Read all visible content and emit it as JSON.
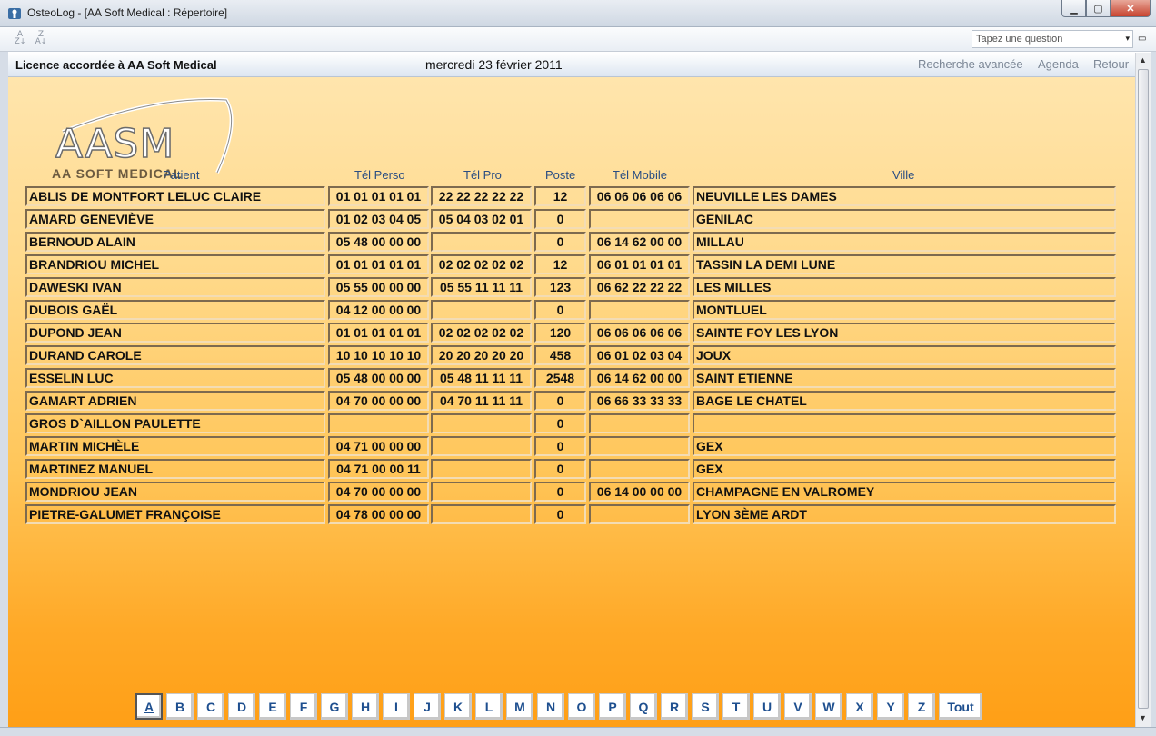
{
  "window": {
    "title": "OsteoLog - [AA Soft Medical : Répertoire]",
    "minimize": "▁",
    "maximize": "▢",
    "close": "✕"
  },
  "toolbar": {
    "sort_asc": "A↓Z",
    "sort_desc": "Z↓A",
    "question_placeholder": "Tapez une question",
    "question_arrow": "▾",
    "restore": "▭"
  },
  "header": {
    "licence": "Licence accordée à AA Soft Medical",
    "date": "mercredi 23 février 2011",
    "links": [
      "Recherche avancée",
      "Agenda",
      "Retour"
    ]
  },
  "logo": {
    "text": "AASM",
    "subtitle": "AA SOFT MEDICAL"
  },
  "columns": [
    "Patient",
    "Tél Perso",
    "Tél Pro",
    "Poste",
    "Tél Mobile",
    "Ville"
  ],
  "patients": [
    {
      "name": "ABLIS DE MONTFORT LELUC CLAIRE",
      "perso": "01 01 01 01 01",
      "pro": "22 22 22 22 22",
      "poste": "12",
      "mobile": "06 06 06 06 06",
      "ville": "NEUVILLE LES DAMES"
    },
    {
      "name": "AMARD GENEVIÈVE",
      "perso": "01 02 03 04 05",
      "pro": "05 04 03 02 01",
      "poste": "0",
      "mobile": "",
      "ville": "GENILAC"
    },
    {
      "name": "BERNOUD ALAIN",
      "perso": "05 48 00 00 00",
      "pro": "",
      "poste": "0",
      "mobile": "06 14 62 00 00",
      "ville": "MILLAU"
    },
    {
      "name": "BRANDRIOU MICHEL",
      "perso": "01 01 01 01 01",
      "pro": "02 02 02 02 02",
      "poste": "12",
      "mobile": "06 01 01 01 01",
      "ville": "TASSIN LA DEMI LUNE"
    },
    {
      "name": "DAWESKI IVAN",
      "perso": "05 55 00 00 00",
      "pro": "05 55 11 11 11",
      "poste": "123",
      "mobile": "06 62 22 22 22",
      "ville": "LES MILLES"
    },
    {
      "name": "DUBOIS GAËL",
      "perso": "04 12 00 00 00",
      "pro": "",
      "poste": "0",
      "mobile": "",
      "ville": "MONTLUEL"
    },
    {
      "name": "DUPOND JEAN",
      "perso": "01 01 01 01 01",
      "pro": "02 02 02 02 02",
      "poste": "120",
      "mobile": "06 06 06 06 06",
      "ville": "SAINTE FOY LES LYON"
    },
    {
      "name": "DURAND CAROLE",
      "perso": "10 10 10 10 10",
      "pro": "20 20 20 20 20",
      "poste": "458",
      "mobile": "06 01 02 03 04",
      "ville": "JOUX"
    },
    {
      "name": "ESSELIN LUC",
      "perso": "05 48 00 00 00",
      "pro": "05 48 11 11 11",
      "poste": "2548",
      "mobile": "06 14 62 00 00",
      "ville": "SAINT ETIENNE"
    },
    {
      "name": "GAMART ADRIEN",
      "perso": "04 70 00 00 00",
      "pro": "04 70 11 11 11",
      "poste": "0",
      "mobile": "06 66 33 33 33",
      "ville": "BAGE LE CHATEL"
    },
    {
      "name": "GROS D`AILLON PAULETTE",
      "perso": "",
      "pro": "",
      "poste": "0",
      "mobile": "",
      "ville": ""
    },
    {
      "name": "MARTIN MICHÈLE",
      "perso": "04 71 00 00 00",
      "pro": "",
      "poste": "0",
      "mobile": "",
      "ville": "GEX"
    },
    {
      "name": "MARTINEZ MANUEL",
      "perso": "04 71 00 00 11",
      "pro": "",
      "poste": "0",
      "mobile": "",
      "ville": "GEX"
    },
    {
      "name": "MONDRIOU JEAN",
      "perso": "04 70 00 00 00",
      "pro": "",
      "poste": "0",
      "mobile": "06 14 00 00 00",
      "ville": "CHAMPAGNE EN VALROMEY"
    },
    {
      "name": "PIETRE-GALUMET FRANÇOISE",
      "perso": "04 78 00 00 00",
      "pro": "",
      "poste": "0",
      "mobile": "",
      "ville": "LYON  3ÈME  ARDT"
    }
  ],
  "alphabet": [
    "A",
    "B",
    "C",
    "D",
    "E",
    "F",
    "G",
    "H",
    "I",
    "J",
    "K",
    "L",
    "M",
    "N",
    "O",
    "P",
    "Q",
    "R",
    "S",
    "T",
    "U",
    "V",
    "W",
    "X",
    "Y",
    "Z",
    "Tout"
  ],
  "alphabet_active": "A",
  "scrollbar": {
    "up": "▲",
    "down": "▼"
  },
  "colors": {
    "accent_orange": "#ff9f16",
    "header_text": "#2a4d82",
    "letter_text": "#1e4f8f"
  }
}
